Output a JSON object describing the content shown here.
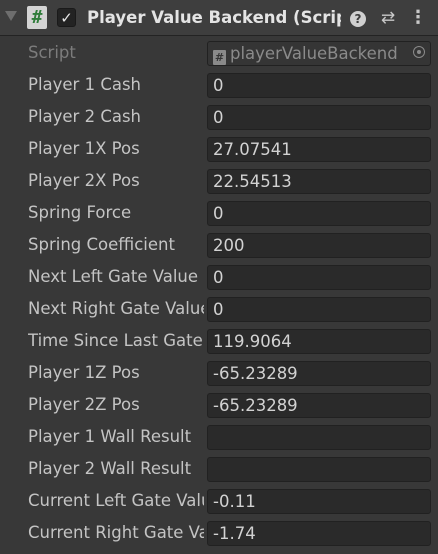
{
  "component": {
    "title": "Player Value Backend (Script",
    "script_icon": "#",
    "enabled_checkmark": "✓",
    "help_icon": "?",
    "presets_icon": "⇄",
    "menu_icon": "⋮"
  },
  "script_row": {
    "label": "Script",
    "icon": "#",
    "value": "playerValueBackend"
  },
  "fields": [
    {
      "label": "Player 1 Cash",
      "value": "0"
    },
    {
      "label": "Player 2 Cash",
      "value": "0"
    },
    {
      "label": "Player 1X Pos",
      "value": "27.07541"
    },
    {
      "label": "Player 2X Pos",
      "value": "22.54513"
    },
    {
      "label": "Spring Force",
      "value": "0"
    },
    {
      "label": "Spring Coefficient",
      "value": "200"
    },
    {
      "label": "Next Left Gate Value",
      "value": "0"
    },
    {
      "label": "Next Right Gate Value",
      "value": "0"
    },
    {
      "label": "Time Since Last Gate",
      "value": "119.9064"
    },
    {
      "label": "Player 1Z Pos",
      "value": "-65.23289"
    },
    {
      "label": "Player 2Z Pos",
      "value": "-65.23289"
    },
    {
      "label": "Player 1 Wall Result",
      "value": ""
    },
    {
      "label": "Player 2 Wall Result",
      "value": ""
    },
    {
      "label": "Current Left Gate Value",
      "value": "-0.11"
    },
    {
      "label": "Current Right Gate Value",
      "value": "-1.74"
    }
  ]
}
